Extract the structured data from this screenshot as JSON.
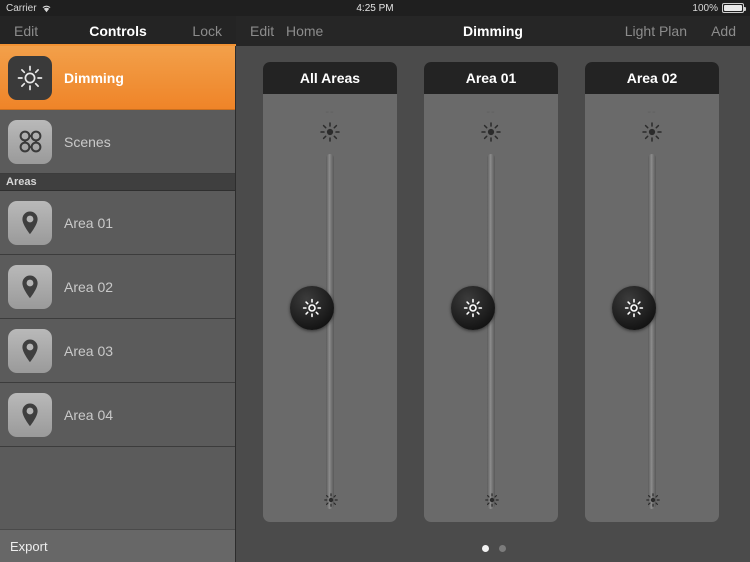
{
  "statusbar": {
    "carrier": "Carrier",
    "wifi_icon": "wifi-icon",
    "time": "4:25 PM",
    "battery_percent": "100%",
    "battery_icon": "battery-full-icon"
  },
  "navbar": {
    "left": {
      "edit_label": "Edit",
      "title": "Controls",
      "lock_label": "Lock"
    },
    "right": {
      "edit_label": "Edit",
      "home_label": "Home",
      "title": "Dimming",
      "light_plan_label": "Light Plan",
      "add_label": "Add"
    }
  },
  "sidebar": {
    "items": [
      {
        "label": "Dimming",
        "icon": "sun-icon",
        "selected": true
      },
      {
        "label": "Scenes",
        "icon": "scenes-grid-icon",
        "selected": false
      }
    ],
    "section_header": "Areas",
    "areas": [
      {
        "label": "Area 01",
        "icon": "location-pin-icon"
      },
      {
        "label": "Area 02",
        "icon": "location-pin-icon"
      },
      {
        "label": "Area 03",
        "icon": "location-pin-icon"
      },
      {
        "label": "Area 04",
        "icon": "location-pin-icon"
      }
    ],
    "export_label": "Export"
  },
  "main": {
    "panels": [
      {
        "title": "All Areas",
        "value": "--",
        "top_icon": "sun-bright-icon",
        "bottom_icon": "sun-dim-icon",
        "thumb_icon": "sun-icon"
      },
      {
        "title": "Area 01",
        "value": "--",
        "top_icon": "sun-bright-icon",
        "bottom_icon": "sun-dim-icon",
        "thumb_icon": "sun-icon"
      },
      {
        "title": "Area 02",
        "value": "--",
        "top_icon": "sun-bright-icon",
        "bottom_icon": "sun-dim-icon",
        "thumb_icon": "sun-icon"
      }
    ],
    "pager": {
      "total": 2,
      "active_index": 0
    }
  },
  "colors": {
    "accent": "#ef8428",
    "sidebar_bg": "#5b5b5b",
    "panel_bg": "#6a6a6a",
    "nav_bg": "#262626"
  }
}
